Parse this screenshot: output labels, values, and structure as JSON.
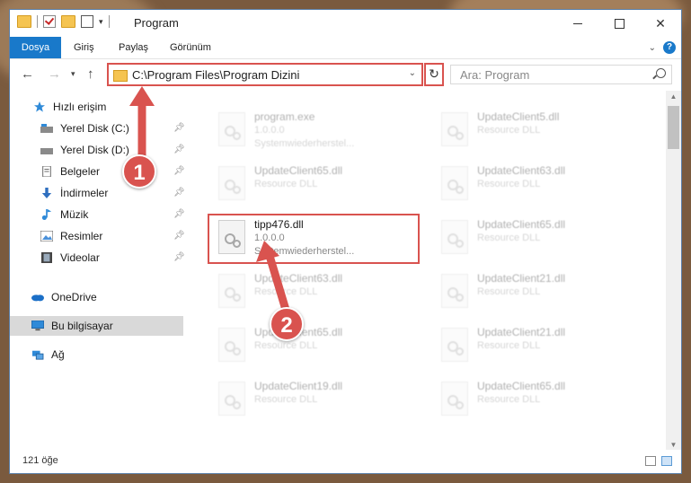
{
  "window": {
    "title": "Program"
  },
  "ribbon": {
    "tabs": [
      "Dosya",
      "Giriş",
      "Paylaş",
      "Görünüm"
    ]
  },
  "address": {
    "path": "C:\\Program Files\\Program Dizini"
  },
  "search": {
    "placeholder": "Ara: Program"
  },
  "sidebar": {
    "items": [
      {
        "label": "Hızlı erişim",
        "icon": "star-icon"
      },
      {
        "label": "Yerel Disk (C:)",
        "icon": "drive-icon",
        "pinned": true
      },
      {
        "label": "Yerel Disk (D:)",
        "icon": "drive-icon",
        "pinned": true
      },
      {
        "label": "Belgeler",
        "icon": "document-icon",
        "pinned": true
      },
      {
        "label": "İndirmeler",
        "icon": "download-icon",
        "pinned": true
      },
      {
        "label": "Müzik",
        "icon": "music-icon",
        "pinned": true
      },
      {
        "label": "Resimler",
        "icon": "pictures-icon",
        "pinned": true
      },
      {
        "label": "Videolar",
        "icon": "video-icon",
        "pinned": true
      },
      {
        "label": "OneDrive",
        "icon": "cloud-icon"
      },
      {
        "label": "Bu bilgisayar",
        "icon": "computer-icon",
        "selected": true
      },
      {
        "label": "Ağ",
        "icon": "network-icon"
      }
    ]
  },
  "files": [
    {
      "name": "program.exe",
      "sub1": "1.0.0.0",
      "sub2": "Systemwiederherstel...",
      "faded": true
    },
    {
      "name": "UpdateClient5.dll",
      "sub1": "Resource DLL",
      "sub2": "",
      "faded": true
    },
    {
      "name": "UpdateClient65.dll",
      "sub1": "Resource DLL",
      "sub2": "",
      "faded": true
    },
    {
      "name": "UpdateClient63.dll",
      "sub1": "Resource DLL",
      "sub2": "",
      "faded": true
    },
    {
      "name": "tipp476.dll",
      "sub1": "1.0.0.0",
      "sub2": "Systemwiederherstel...",
      "faded": false
    },
    {
      "name": "UpdateClient65.dll",
      "sub1": "Resource DLL",
      "sub2": "",
      "faded": true
    },
    {
      "name": "UpdateClient63.dll",
      "sub1": "Resource DLL",
      "sub2": "",
      "faded": true
    },
    {
      "name": "UpdateClient21.dll",
      "sub1": "Resource DLL",
      "sub2": "",
      "faded": true
    },
    {
      "name": "UpdateClient65.dll",
      "sub1": "Resource DLL",
      "sub2": "",
      "faded": true
    },
    {
      "name": "UpdateClient21.dll",
      "sub1": "Resource DLL",
      "sub2": "",
      "faded": true
    },
    {
      "name": "UpdateClient19.dll",
      "sub1": "Resource DLL",
      "sub2": "",
      "faded": true
    },
    {
      "name": "UpdateClient65.dll",
      "sub1": "Resource DLL",
      "sub2": "",
      "faded": true
    }
  ],
  "status": {
    "count_text": "121 öğe"
  },
  "annotations": [
    {
      "label": "1"
    },
    {
      "label": "2"
    }
  ],
  "colors": {
    "accent": "#1979ca",
    "annotation": "#d9534f"
  }
}
